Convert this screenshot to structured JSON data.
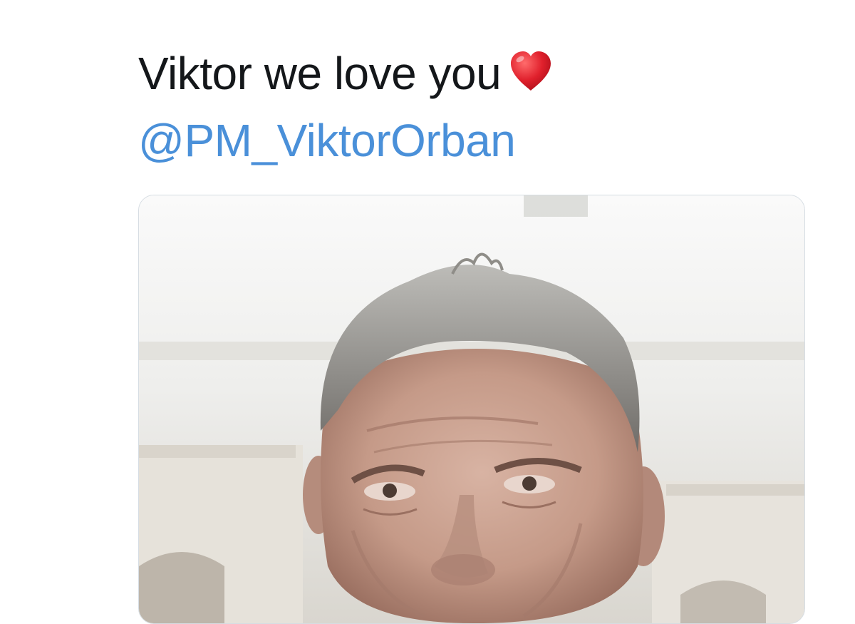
{
  "tweet": {
    "text": "Viktor we love you",
    "emoji": "red-heart-icon",
    "mention": "@PM_ViktorOrban"
  },
  "media": {
    "kind": "photo",
    "subject": "man-portrait-photo"
  },
  "colors": {
    "text": "#14171a",
    "link": "#4a90d9",
    "card_border": "#d6dde3",
    "heart": "#d8202c"
  }
}
